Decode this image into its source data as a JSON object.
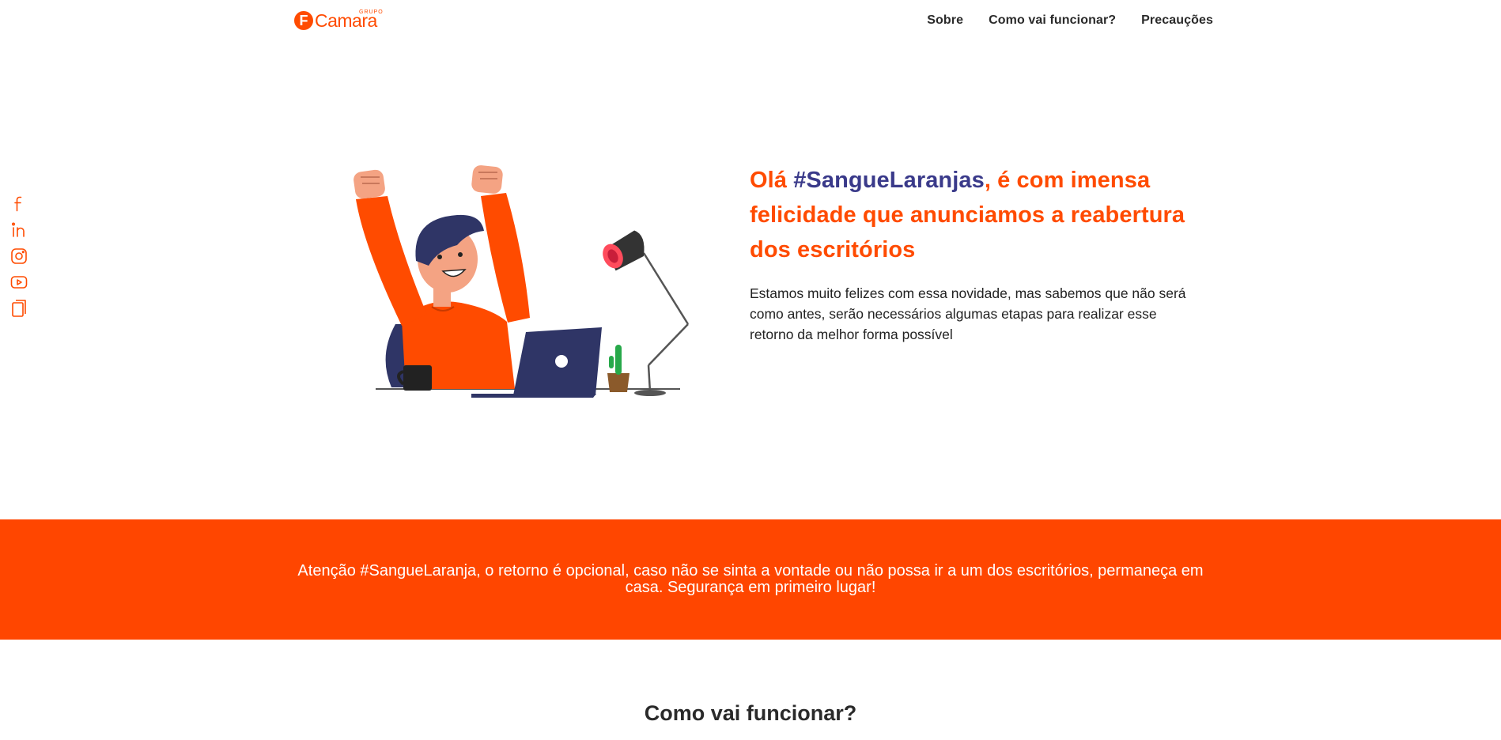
{
  "header": {
    "logo": {
      "small": "GRUPO",
      "word": "Camara",
      "mark": "F"
    },
    "nav": [
      "Sobre",
      "Como vai funcionar?",
      "Precauções"
    ]
  },
  "social": [
    "facebook-icon",
    "linkedin-icon",
    "instagram-icon",
    "youtube-icon",
    "blog-icon"
  ],
  "hero": {
    "title_prefix": "Olá ",
    "title_tag": "#SangueLaranjas",
    "title_suffix": ", é com imensa felicidade que anunciamos a reabertura dos escritórios",
    "description": "Estamos muito felizes com essa novidade, mas sabemos que não será como antes, serão necessários algumas etapas para realizar esse retorno da melhor forma possível"
  },
  "banner": {
    "text": "Atenção #SangueLaranja, o retorno é opcional, caso não se sinta a vontade ou não possa ir a um dos escritórios, permaneça em casa. Segurança em primeiro lugar!"
  },
  "section": {
    "title": "Como vai funcionar?"
  },
  "colors": {
    "brand_orange": "#ff4b00",
    "banner_orange": "#ff4600",
    "tag_blue": "#3a3a8a",
    "laptop_navy": "#2f3566"
  }
}
